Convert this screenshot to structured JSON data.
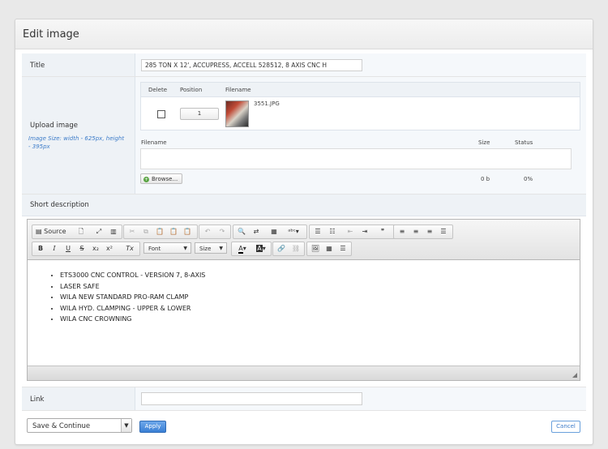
{
  "panel": {
    "title": "Edit image"
  },
  "title_field": {
    "label": "Title",
    "value": "285 TON X 12', ACCUPRESS, ACCELL 528512, 8 AXIS CNC H"
  },
  "upload": {
    "label": "Upload image",
    "hint": "Image Size: width - 625px, height - 395px",
    "grid_headers": {
      "delete": "Delete",
      "position": "Position",
      "filename": "Filename"
    },
    "row": {
      "position": "1",
      "filename": "3551.JPG"
    },
    "new_headers": {
      "filename": "Filename",
      "size": "Size",
      "status": "Status"
    },
    "browse_label": "Browse...",
    "size_value": "0 b",
    "status_value": "0%"
  },
  "short_description": {
    "label": "Short description",
    "toolbar": {
      "source": "Source",
      "font": "Font",
      "size": "Size",
      "bold": "B",
      "italic": "I",
      "underline": "U",
      "strike": "S",
      "subscript": "x₂",
      "superscript": "x²",
      "remove_format": "Tx",
      "text_color": "A",
      "bg_color": "A",
      "blockquote": "❞"
    },
    "items": [
      "ETS3000 CNC CONTROL - VERSION 7, 8-AXIS",
      "LASER SAFE",
      "WILA NEW STANDARD PRO-RAM CLAMP",
      "WILA HYD. CLAMPING - UPPER & LOWER",
      "WILA CNC CROWNING"
    ]
  },
  "link_field": {
    "label": "Link",
    "value": ""
  },
  "footer": {
    "save_select": "Save & Continue",
    "apply": "Apply",
    "cancel": "Cancel"
  },
  "colors": {
    "accent": "#3a7fd5",
    "label_bg": "#eef2f6",
    "hint": "#3d7cc9"
  }
}
